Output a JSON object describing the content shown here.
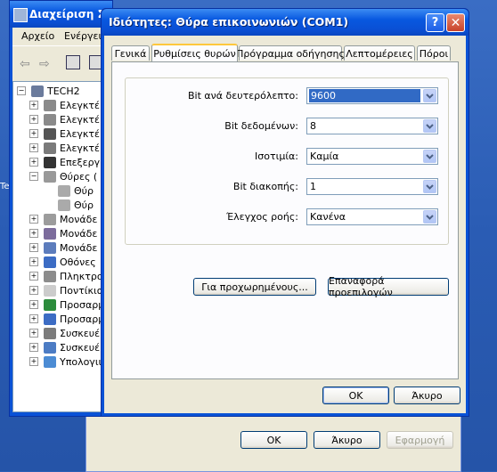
{
  "desktop": {
    "left_fragment": "Te"
  },
  "device_manager": {
    "title": "Διαχείριση Σ",
    "menu": [
      "Αρχείο",
      "Ενέργεια"
    ],
    "tree": [
      {
        "label": "TECH2",
        "level": 0,
        "expander": "-",
        "icon_color": "#6b7b9c"
      },
      {
        "label": "Ελεγκτέ",
        "level": 1,
        "expander": "+",
        "icon_color": "#8a8a8a"
      },
      {
        "label": "Ελεγκτέ",
        "level": 1,
        "expander": "+",
        "icon_color": "#8a8a8a"
      },
      {
        "label": "Ελεγκτέ",
        "level": 1,
        "expander": "+",
        "icon_color": "#555555"
      },
      {
        "label": "Ελεγκτέ",
        "level": 1,
        "expander": "+",
        "icon_color": "#7a7a7a"
      },
      {
        "label": "Επεξεργ",
        "level": 1,
        "expander": "+",
        "icon_color": "#333333"
      },
      {
        "label": "Θύρες (",
        "level": 1,
        "expander": "-",
        "icon_color": "#999999"
      },
      {
        "label": "Θύρ",
        "level": 2,
        "expander": "",
        "icon_color": "#aaaaaa"
      },
      {
        "label": "Θύρ",
        "level": 2,
        "expander": "",
        "icon_color": "#aaaaaa"
      },
      {
        "label": "Μονάδε",
        "level": 1,
        "expander": "+",
        "icon_color": "#9c9c9c"
      },
      {
        "label": "Μονάδε",
        "level": 1,
        "expander": "+",
        "icon_color": "#7c6c9c"
      },
      {
        "label": "Μονάδε",
        "level": 1,
        "expander": "+",
        "icon_color": "#5c7cbc"
      },
      {
        "label": "Οθόνες",
        "level": 1,
        "expander": "+",
        "icon_color": "#3c6cc4"
      },
      {
        "label": "Πληκτρο",
        "level": 1,
        "expander": "+",
        "icon_color": "#8c8c8c"
      },
      {
        "label": "Ποντίκια",
        "level": 1,
        "expander": "+",
        "icon_color": "#cccccc"
      },
      {
        "label": "Προσαρμ",
        "level": 1,
        "expander": "+",
        "icon_color": "#2c8c3c"
      },
      {
        "label": "Προσαρμ",
        "level": 1,
        "expander": "+",
        "icon_color": "#3c6cc4"
      },
      {
        "label": "Συσκευέ",
        "level": 1,
        "expander": "+",
        "icon_color": "#7c7c7c"
      },
      {
        "label": "Συσκευέ",
        "level": 1,
        "expander": "+",
        "icon_color": "#4c7cc4"
      },
      {
        "label": "Υπολογιι",
        "level": 1,
        "expander": "+",
        "icon_color": "#4c8cd4"
      }
    ]
  },
  "dialog": {
    "title": "Ιδιότητες: Θύρα επικοινωνιών (COM1)",
    "help_glyph": "?",
    "close_glyph": "✕",
    "tabs": [
      "Γενικά",
      "Ρυθμίσεις θυρών",
      "Πρόγραμμα οδήγησης",
      "Λεπτομέρειες",
      "Πόροι"
    ],
    "active_tab": 1,
    "fields": [
      {
        "label": "Bit ανά δευτερόλεπτο:",
        "value": "9600",
        "selected": true
      },
      {
        "label": "Bit δεδομένων:",
        "value": "8",
        "selected": false
      },
      {
        "label": "Ισοτιμία:",
        "value": "Καμία",
        "selected": false
      },
      {
        "label": "Bit διακοπής:",
        "value": "1",
        "selected": false
      },
      {
        "label": "Έλεγχος ροής:",
        "value": "Κανένα",
        "selected": false
      }
    ],
    "advanced_button": "Για προχωρημένους...",
    "restore_button": "Επαναφορά προεπιλογών",
    "ok_button": "OK",
    "cancel_button": "Άκυρο"
  },
  "back_dialog": {
    "ok_button": "OK",
    "cancel_button": "Άκυρο",
    "apply_button": "Εφαρμογή"
  },
  "colors": {
    "titlebar_blue": "#0a52d6",
    "dialog_face": "#ece9d8",
    "tab_accent": "#ffc83c",
    "selection": "#316ac5"
  }
}
